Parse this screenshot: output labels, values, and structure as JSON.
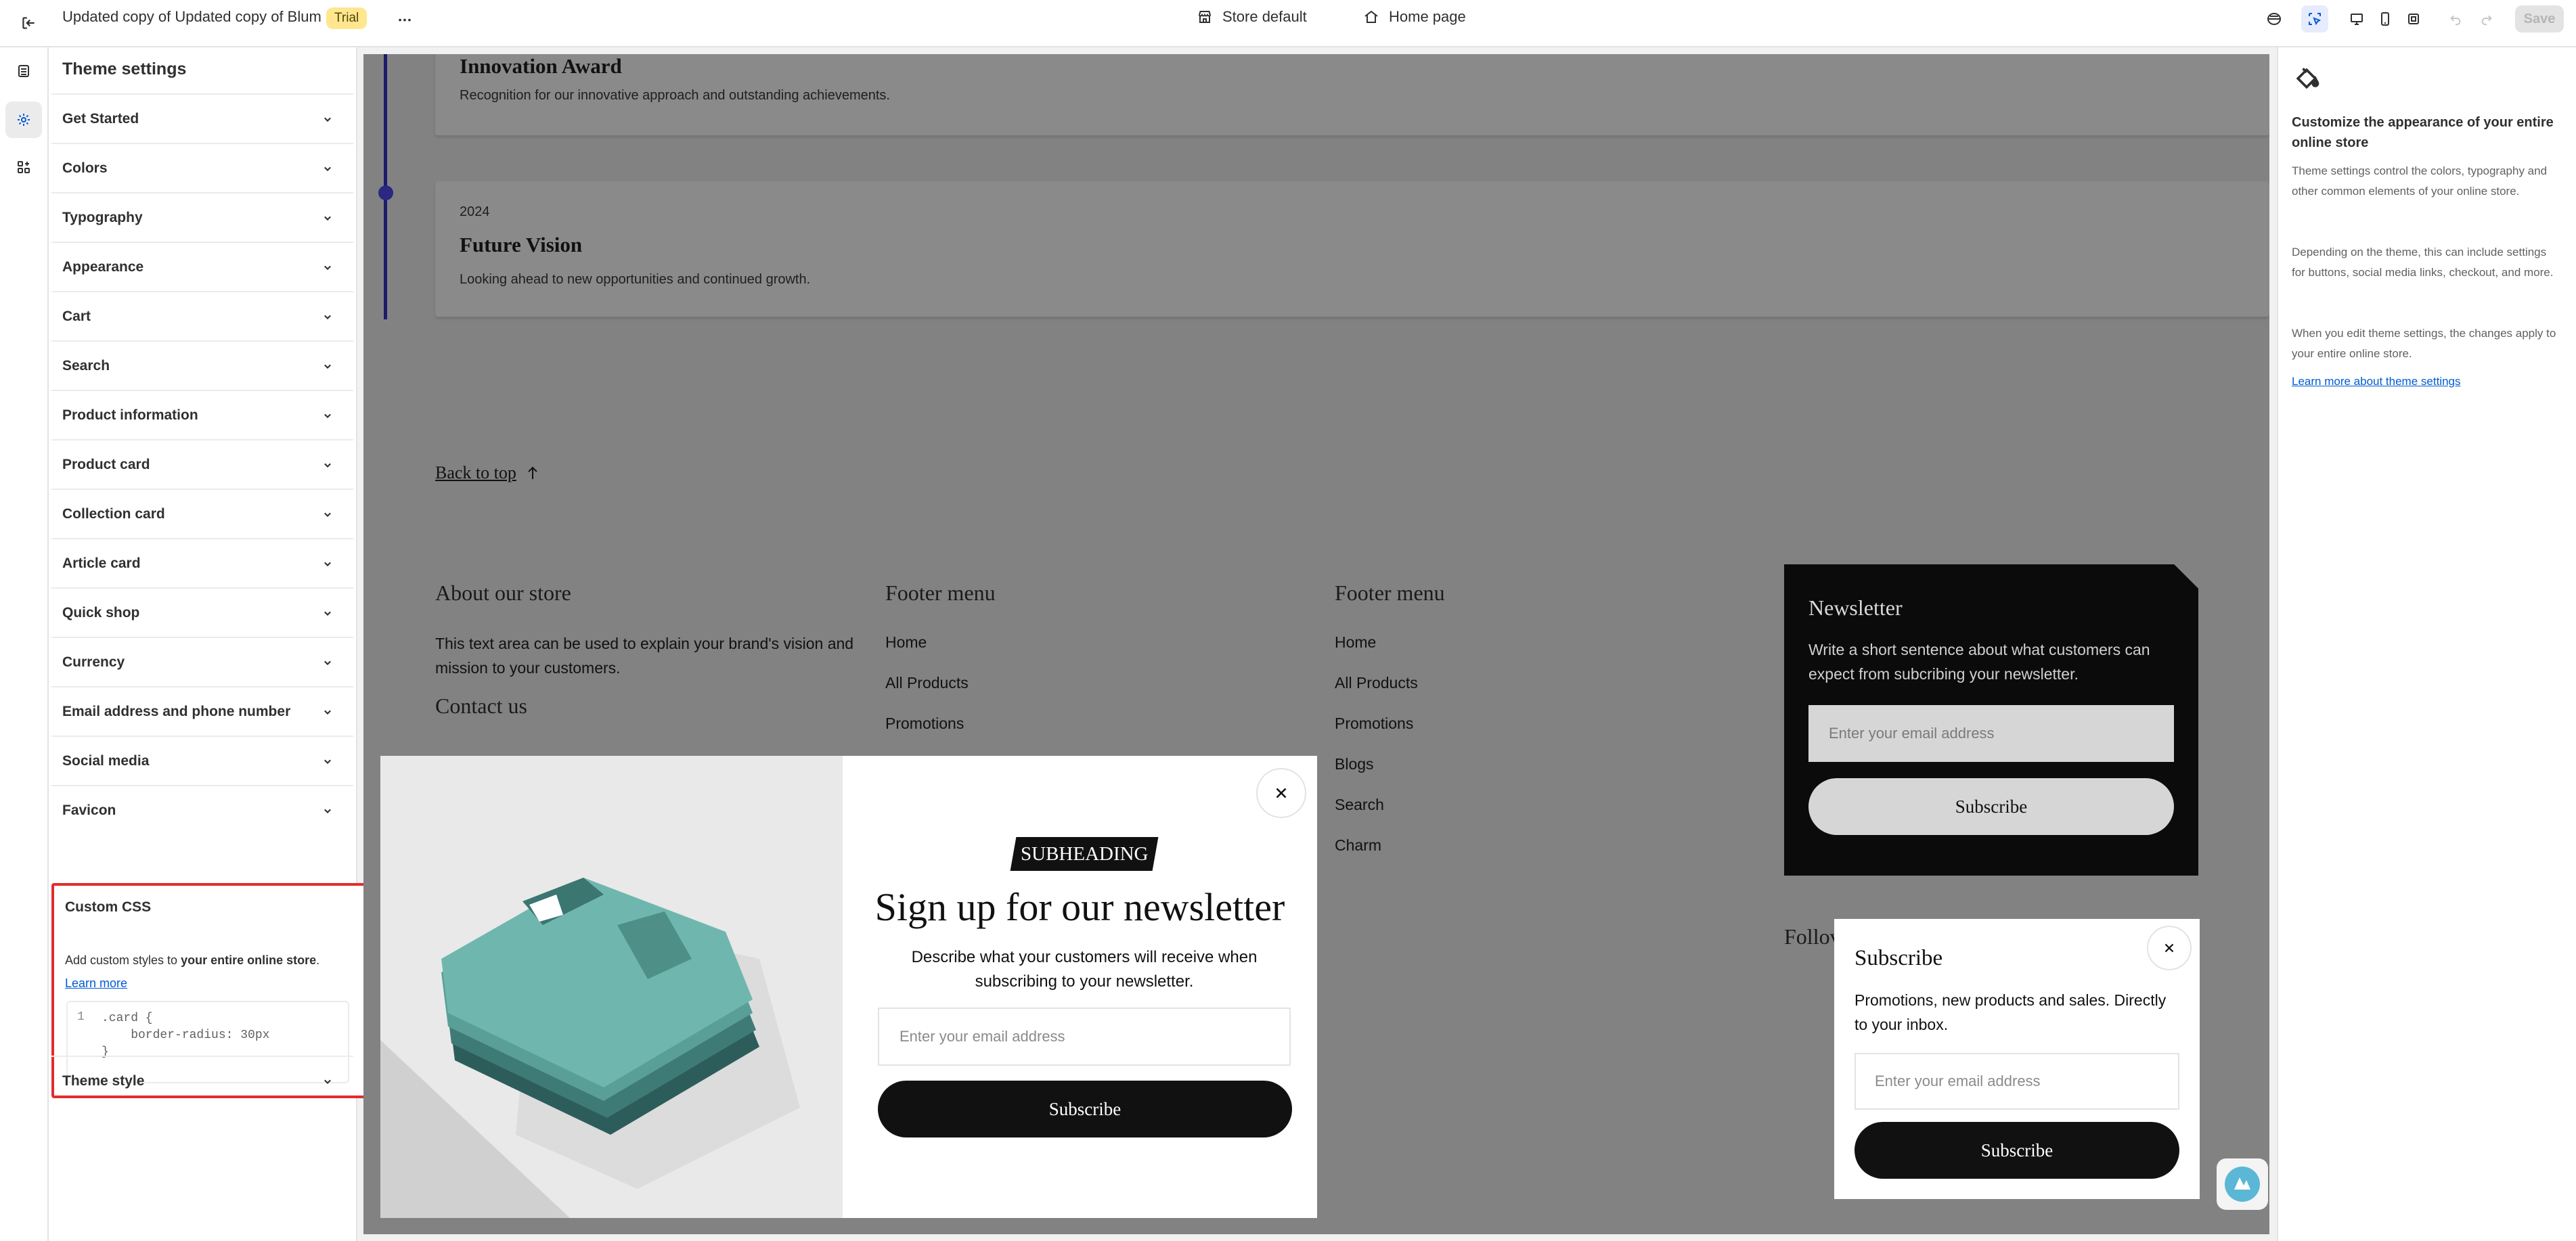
{
  "topbar": {
    "title": "Updated copy of Updated copy of Blum",
    "badge": "Trial",
    "more": "•••",
    "store": "Store default",
    "page": "Home page",
    "save": "Save"
  },
  "sidebar": {
    "heading": "Theme settings",
    "items": [
      {
        "label": "Get Started"
      },
      {
        "label": "Colors"
      },
      {
        "label": "Typography"
      },
      {
        "label": "Appearance"
      },
      {
        "label": "Cart"
      },
      {
        "label": "Search"
      },
      {
        "label": "Product information"
      },
      {
        "label": "Product card"
      },
      {
        "label": "Collection card"
      },
      {
        "label": "Article card"
      },
      {
        "label": "Quick shop"
      },
      {
        "label": "Currency"
      },
      {
        "label": "Email address and phone number"
      },
      {
        "label": "Social media"
      },
      {
        "label": "Favicon"
      }
    ],
    "custom_css": {
      "label": "Custom CSS",
      "desc_prefix": "Add custom styles to ",
      "desc_bold": "your entire online store",
      "desc_suffix": ".",
      "learn_more": "Learn more",
      "line_number": "1",
      "code": ".card {\n    border-radius: 30px\n}"
    },
    "theme_style": "Theme style"
  },
  "preview": {
    "timeline": [
      {
        "year": "",
        "title": "Innovation Award",
        "text": "Recognition for our innovative approach and outstanding achievements."
      },
      {
        "year": "2024",
        "title": "Future Vision",
        "text": "Looking ahead to new opportunities and continued growth."
      }
    ],
    "back_to_top": "Back to top",
    "about": {
      "title": "About our store",
      "text": "This text area can be used to explain your brand's vision and mission to your customers.",
      "contact": "Contact us"
    },
    "footer_menu_1": {
      "title": "Footer menu",
      "links": [
        "Home",
        "All Products",
        "Promotions"
      ]
    },
    "footer_menu_2": {
      "title": "Footer menu",
      "links": [
        "Home",
        "All Products",
        "Promotions",
        "Blogs",
        "Search",
        "Charm"
      ]
    },
    "newsletter": {
      "title": "Newsletter",
      "text": "Write a short sentence about what customers can expect from subcribing your newsletter.",
      "placeholder": "Enter your email address",
      "button": "Subscribe"
    },
    "follow_partial": "Follov",
    "popup": {
      "subheading": "SUBHEADING",
      "title": "Sign up for our newsletter",
      "desc": "Describe what your customers will receive when subscribing to your newsletter.",
      "placeholder": "Enter your email address",
      "button": "Subscribe"
    },
    "mini_popup": {
      "title": "Subscribe",
      "desc": "Promotions, new products and sales. Directly to your inbox.",
      "placeholder": "Enter your email address",
      "button": "Subscribe"
    }
  },
  "info_panel": {
    "title": "Customize the appearance of your entire online store",
    "p1": "Theme settings control the colors, typography and other common elements of your online store.",
    "p2": "Depending on the theme, this can include settings for buttons, social media links, checkout, and more.",
    "p3": "When you edit theme settings, the changes apply to your entire online store.",
    "link": "Learn more about theme settings"
  },
  "colors": {
    "accent": "#005bd3",
    "highlight_border": "#e22c2c",
    "trial_bg": "#ffe68f"
  }
}
